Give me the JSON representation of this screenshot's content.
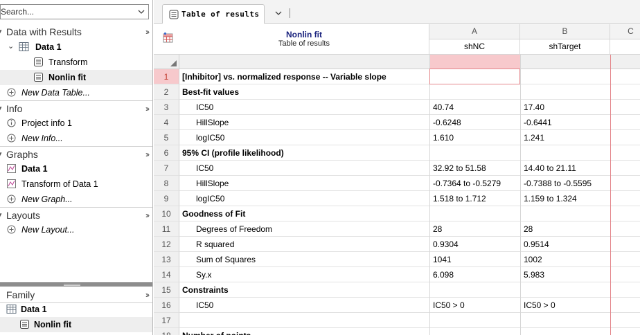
{
  "navigator": {
    "search_placeholder": "Search...",
    "sections": {
      "data": {
        "title": "Data with Results",
        "items": [
          {
            "label": "Data 1",
            "icon": "data-table-icon"
          },
          {
            "label": "Transform",
            "icon": "results-sheet-icon"
          },
          {
            "label": "Nonlin fit",
            "icon": "results-sheet-icon",
            "selected": true
          },
          {
            "label": "New Data Table...",
            "icon": "add-circle-icon"
          }
        ]
      },
      "info": {
        "title": "Info",
        "items": [
          {
            "label": "Project info 1",
            "icon": "info-icon"
          },
          {
            "label": "New Info...",
            "icon": "add-circle-icon"
          }
        ]
      },
      "graphs": {
        "title": "Graphs",
        "items": [
          {
            "label": "Data 1",
            "icon": "graph-icon"
          },
          {
            "label": "Transform of Data 1",
            "icon": "graph-icon"
          },
          {
            "label": "New Graph...",
            "icon": "add-circle-icon"
          }
        ]
      },
      "layouts": {
        "title": "Layouts",
        "items": [
          {
            "label": "New Layout...",
            "icon": "add-circle-icon"
          }
        ]
      }
    },
    "family": {
      "title": "Family",
      "items": [
        {
          "label": "Data 1",
          "icon": "data-table-icon"
        },
        {
          "label": "Nonlin fit",
          "icon": "results-sheet-icon",
          "selected": true
        }
      ]
    }
  },
  "tab": {
    "label": "Table of results"
  },
  "sheet": {
    "header": {
      "title": "Nonlin fit",
      "subtitle": "Table of results"
    },
    "columns": [
      {
        "letter": "A",
        "name": "shNC"
      },
      {
        "letter": "B",
        "name": "shTarget"
      },
      {
        "letter": "C",
        "name": ""
      }
    ],
    "rows": [
      {
        "num": "1",
        "label": "[Inhibitor] vs. normalized response -- Variable slope",
        "kind": "title",
        "a": "",
        "b": ""
      },
      {
        "num": "2",
        "label": "Best-fit values",
        "kind": "title",
        "a": "",
        "b": ""
      },
      {
        "num": "3",
        "label": "IC50",
        "kind": "sub",
        "a": "40.74",
        "b": "17.40"
      },
      {
        "num": "4",
        "label": "HillSlope",
        "kind": "sub",
        "a": "-0.6248",
        "b": "-0.6441"
      },
      {
        "num": "5",
        "label": "logIC50",
        "kind": "sub",
        "a": "1.610",
        "b": "1.241"
      },
      {
        "num": "6",
        "label": "95% CI (profile likelihood)",
        "kind": "title",
        "a": "",
        "b": ""
      },
      {
        "num": "7",
        "label": "IC50",
        "kind": "sub",
        "a": "32.92 to 51.58",
        "b": "14.40 to 21.11"
      },
      {
        "num": "8",
        "label": "HillSlope",
        "kind": "sub",
        "a": "-0.7364 to -0.5279",
        "b": "-0.7388 to -0.5595"
      },
      {
        "num": "9",
        "label": "logIC50",
        "kind": "sub",
        "a": "1.518 to 1.712",
        "b": "1.159 to 1.324"
      },
      {
        "num": "10",
        "label": "Goodness of Fit",
        "kind": "title",
        "a": "",
        "b": ""
      },
      {
        "num": "11",
        "label": "Degrees of Freedom",
        "kind": "sub",
        "a": "28",
        "b": "28"
      },
      {
        "num": "12",
        "label": "R squared",
        "kind": "sub",
        "a": "0.9304",
        "b": "0.9514"
      },
      {
        "num": "13",
        "label": "Sum of Squares",
        "kind": "sub",
        "a": "1041",
        "b": "1002"
      },
      {
        "num": "14",
        "label": "Sy.x",
        "kind": "sub",
        "a": "6.098",
        "b": "5.983"
      },
      {
        "num": "15",
        "label": "Constraints",
        "kind": "title",
        "a": "",
        "b": ""
      },
      {
        "num": "16",
        "label": "IC50",
        "kind": "sub",
        "a": "IC50 > 0",
        "b": "IC50 > 0"
      },
      {
        "num": "17",
        "label": "",
        "kind": "sub",
        "a": "",
        "b": ""
      },
      {
        "num": "18",
        "label": "Number of points",
        "kind": "title",
        "a": "",
        "b": ""
      }
    ]
  },
  "colors": {
    "header_title": "#1a237e",
    "selection_fill": "#f7c9cc",
    "selection_border": "#e4868b"
  }
}
